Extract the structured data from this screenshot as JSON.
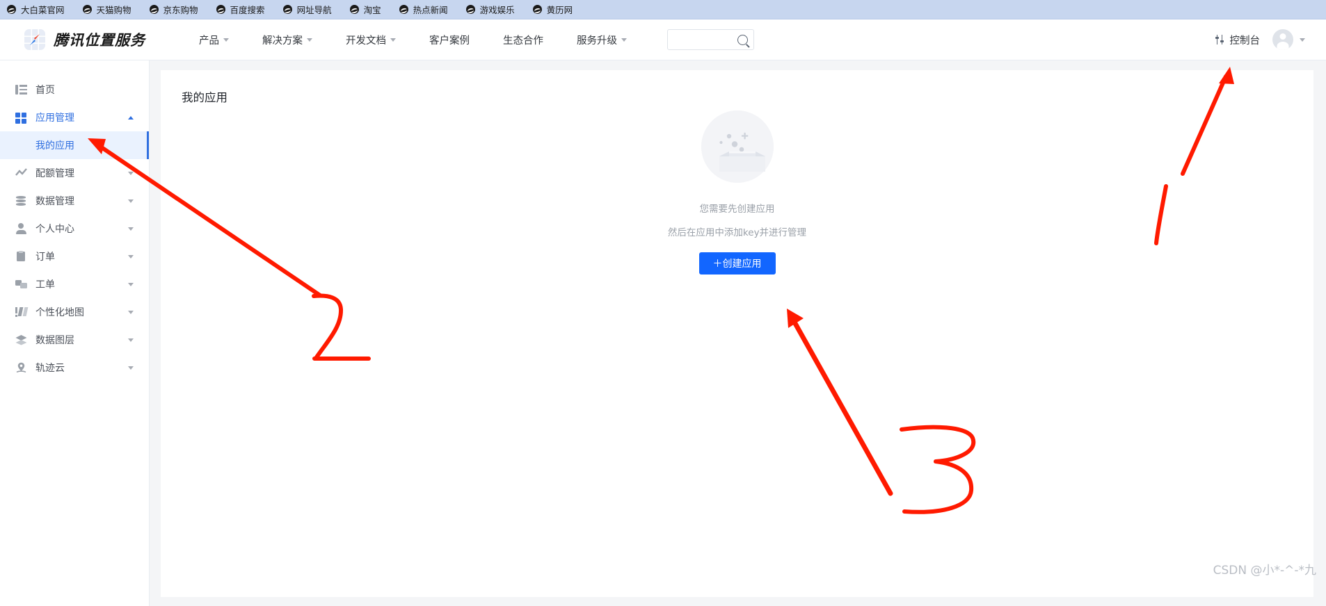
{
  "browser": {
    "bookmarks": [
      {
        "label": "大白菜官网",
        "icon": "globe-icon"
      },
      {
        "label": "天猫购物",
        "icon": "globe-icon"
      },
      {
        "label": "京东购物",
        "icon": "globe-icon"
      },
      {
        "label": "百度搜索",
        "icon": "globe-icon"
      },
      {
        "label": "网址导航",
        "icon": "globe-icon"
      },
      {
        "label": "淘宝",
        "icon": "globe-icon"
      },
      {
        "label": "热点新闻",
        "icon": "globe-icon"
      },
      {
        "label": "游戏娱乐",
        "icon": "globe-icon"
      },
      {
        "label": "黄历网",
        "icon": "globe-icon"
      }
    ]
  },
  "header": {
    "brand": "腾讯位置服务",
    "logo_icon": "compass-logo-icon",
    "nav": [
      {
        "label": "产品",
        "has_dropdown": true
      },
      {
        "label": "解决方案",
        "has_dropdown": true
      },
      {
        "label": "开发文档",
        "has_dropdown": true
      },
      {
        "label": "客户案例",
        "has_dropdown": false
      },
      {
        "label": "生态合作",
        "has_dropdown": false
      },
      {
        "label": "服务升级",
        "has_dropdown": true
      }
    ],
    "search": {
      "value": "",
      "placeholder": "",
      "icon": "search-icon"
    },
    "console": {
      "label": "控制台",
      "icon": "sliders-icon"
    },
    "avatar": {
      "icon": "avatar-icon",
      "dropdown_icon": "chevron-down-icon"
    }
  },
  "sidebar": {
    "items": [
      {
        "label": "首页",
        "icon": "home-icon",
        "expandable": false,
        "state": "normal"
      },
      {
        "label": "应用管理",
        "icon": "grid-icon",
        "expandable": true,
        "state": "expanded"
      },
      {
        "label": "配额管理",
        "icon": "chart-icon",
        "expandable": true,
        "state": "collapsed"
      },
      {
        "label": "数据管理",
        "icon": "database-icon",
        "expandable": true,
        "state": "collapsed"
      },
      {
        "label": "个人中心",
        "icon": "user-icon",
        "expandable": true,
        "state": "collapsed"
      },
      {
        "label": "订单",
        "icon": "clipboard-icon",
        "expandable": true,
        "state": "collapsed"
      },
      {
        "label": "工单",
        "icon": "ticket-icon",
        "expandable": true,
        "state": "collapsed"
      },
      {
        "label": "个性化地图",
        "icon": "map-style-icon",
        "expandable": true,
        "state": "collapsed"
      },
      {
        "label": "数据图层",
        "icon": "layers-icon",
        "expandable": true,
        "state": "collapsed"
      },
      {
        "label": "轨迹云",
        "icon": "track-cloud-icon",
        "expandable": true,
        "state": "collapsed"
      }
    ],
    "submenu": {
      "label": "我的应用",
      "selected": true
    }
  },
  "main": {
    "card_title": "我的应用",
    "empty_state": {
      "illustration": "empty-box-icon",
      "line1": "您需要先创建应用",
      "line2": "然后在应用中添加key并进行管理",
      "button_label": "＋创建应用"
    }
  },
  "annotations": {
    "color": "#ff1a00",
    "marks": [
      {
        "label": "1",
        "points_to": "控制台"
      },
      {
        "label": "2",
        "points_to": "我的应用"
      },
      {
        "label": "3",
        "points_to": "＋创建应用"
      }
    ]
  },
  "watermark": {
    "text": "CSDN @小*-^-*九"
  },
  "colors": {
    "accent": "#2f6fe0",
    "button": "#1266ff",
    "selected_bg": "#eaf2fe",
    "bookmark_bar": "#c7d6ef",
    "page_bg": "#f4f5f7",
    "annotation": "#ff1a00"
  }
}
